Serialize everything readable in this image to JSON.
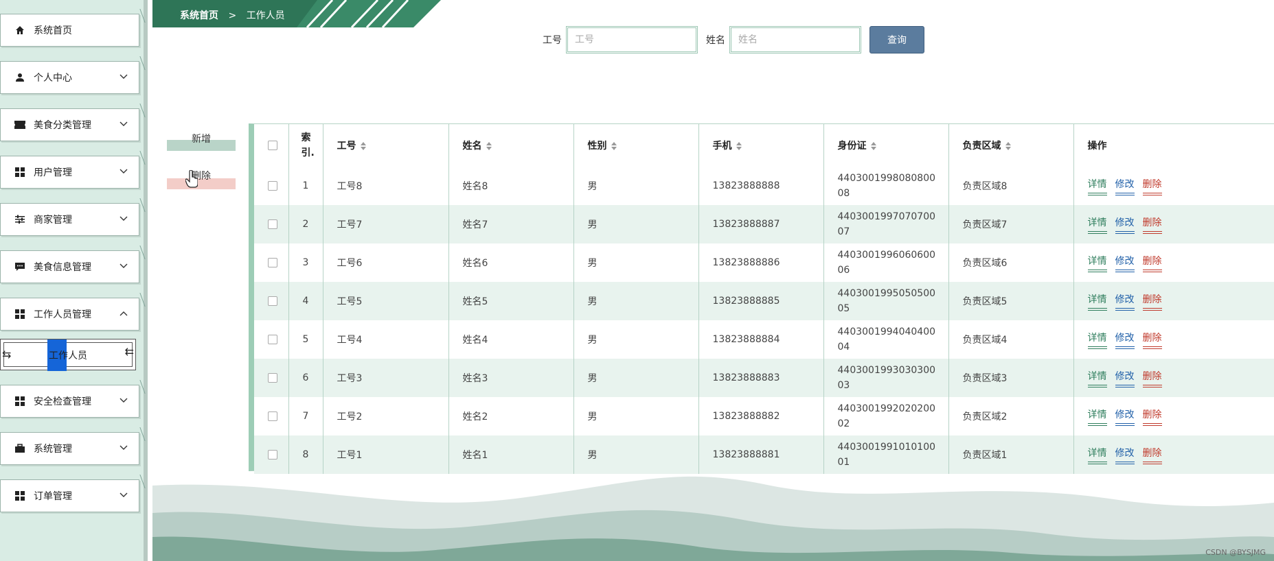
{
  "sidebar": {
    "items": [
      {
        "label": "系统首页",
        "icon": "home-icon",
        "expandable": false
      },
      {
        "label": "个人中心",
        "icon": "user-icon",
        "expandable": true
      },
      {
        "label": "美食分类管理",
        "icon": "ticket-icon",
        "expandable": true
      },
      {
        "label": "用户管理",
        "icon": "grid-icon",
        "expandable": true
      },
      {
        "label": "商家管理",
        "icon": "sliders-icon",
        "expandable": true
      },
      {
        "label": "美食信息管理",
        "icon": "chat-icon",
        "expandable": true
      },
      {
        "label": "工作人员管理",
        "icon": "grid-icon",
        "expandable": true,
        "expanded": true
      },
      {
        "label": "安全检查管理",
        "icon": "grid-icon",
        "expandable": true
      },
      {
        "label": "系统管理",
        "icon": "briefcase-icon",
        "expandable": true
      },
      {
        "label": "订单管理",
        "icon": "grid-icon",
        "expandable": true
      }
    ],
    "sub_item": {
      "label": "工作人员"
    }
  },
  "breadcrumb": {
    "home": "系统首页",
    "separator": ">",
    "current": "工作人员"
  },
  "search": {
    "fields": [
      {
        "label": "工号",
        "placeholder": "工号",
        "value": ""
      },
      {
        "label": "姓名",
        "placeholder": "姓名",
        "value": ""
      }
    ],
    "button": "查询"
  },
  "actions": {
    "add": "新增",
    "delete": "删除"
  },
  "table": {
    "headers": {
      "index": "索引.",
      "worker_no": "工号",
      "name": "姓名",
      "gender": "性别",
      "phone": "手机",
      "id_card": "身份证",
      "area": "负责区域",
      "ops": "操作"
    },
    "rows": [
      {
        "index": "1",
        "worker_no": "工号8",
        "name": "姓名8",
        "gender": "男",
        "phone": "13823888888",
        "id_card": "440300199808080008",
        "area": "负责区域8"
      },
      {
        "index": "2",
        "worker_no": "工号7",
        "name": "姓名7",
        "gender": "男",
        "phone": "13823888887",
        "id_card": "440300199707070007",
        "area": "负责区域7"
      },
      {
        "index": "3",
        "worker_no": "工号6",
        "name": "姓名6",
        "gender": "男",
        "phone": "13823888886",
        "id_card": "440300199606060006",
        "area": "负责区域6"
      },
      {
        "index": "4",
        "worker_no": "工号5",
        "name": "姓名5",
        "gender": "男",
        "phone": "13823888885",
        "id_card": "440300199505050005",
        "area": "负责区域5"
      },
      {
        "index": "5",
        "worker_no": "工号4",
        "name": "姓名4",
        "gender": "男",
        "phone": "13823888884",
        "id_card": "440300199404040004",
        "area": "负责区域4"
      },
      {
        "index": "6",
        "worker_no": "工号3",
        "name": "姓名3",
        "gender": "男",
        "phone": "13823888883",
        "id_card": "440300199303030003",
        "area": "负责区域3"
      },
      {
        "index": "7",
        "worker_no": "工号2",
        "name": "姓名2",
        "gender": "男",
        "phone": "13823888882",
        "id_card": "440300199202020002",
        "area": "负责区域2"
      },
      {
        "index": "8",
        "worker_no": "工号1",
        "name": "姓名1",
        "gender": "男",
        "phone": "13823888881",
        "id_card": "440300199101010001",
        "area": "负责区域1"
      }
    ],
    "ops": {
      "detail": "详情",
      "edit": "修改",
      "delete": "删除"
    }
  },
  "watermark": "CSDN @BYSJMG",
  "colors": {
    "accent": "#2e7d5c",
    "sidebar_bg": "#d9ece4",
    "query_btn": "#5b7c9e",
    "alt_row": "#e8f3ee"
  }
}
